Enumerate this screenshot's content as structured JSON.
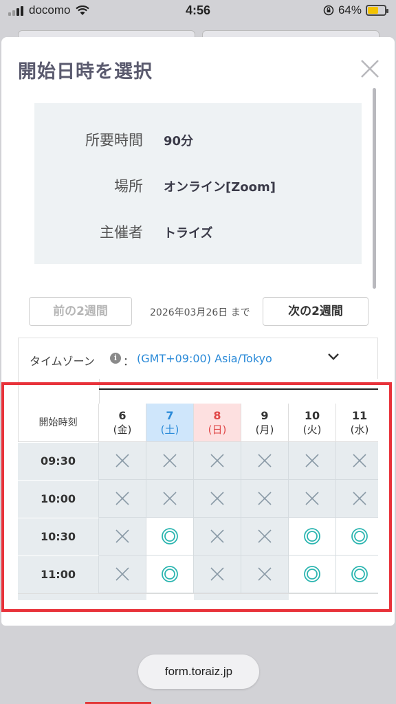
{
  "status_bar": {
    "carrier": "docomo",
    "time": "4:56",
    "battery": "64%",
    "battery_level": 0.64,
    "battery_color": "#f2c200"
  },
  "modal": {
    "title": "開始日時を選択",
    "close_icon": "close-icon",
    "info": [
      {
        "label": "所要時間",
        "value": "90分"
      },
      {
        "label": "場所",
        "value": "オンライン[Zoom]"
      },
      {
        "label": "主催者",
        "value": "トライズ"
      }
    ],
    "nav": {
      "prev_label": "前の2週間",
      "until_text": "2026年03月26日 まで",
      "next_label": "次の2週間"
    },
    "timezone": {
      "label": "タイムゾーン",
      "info_icon": "i",
      "colon": "：",
      "value": "(GMT+09:00) Asia/Tokyo"
    },
    "calendar": {
      "header_label": "開始時刻",
      "days": [
        {
          "num": "6",
          "weekday": "(金)",
          "kind": "weekday"
        },
        {
          "num": "7",
          "weekday": "(土)",
          "kind": "sat"
        },
        {
          "num": "8",
          "weekday": "(日)",
          "kind": "sun"
        },
        {
          "num": "9",
          "weekday": "(月)",
          "kind": "weekday"
        },
        {
          "num": "10",
          "weekday": "(火)",
          "kind": "weekday"
        },
        {
          "num": "11",
          "weekday": "(水)",
          "kind": "weekday"
        }
      ],
      "rows": [
        {
          "time": "09:30",
          "slots": [
            "x",
            "x",
            "x",
            "x",
            "x",
            "x"
          ]
        },
        {
          "time": "10:00",
          "slots": [
            "x",
            "x",
            "x",
            "x",
            "x",
            "x"
          ]
        },
        {
          "time": "10:30",
          "slots": [
            "x",
            "o",
            "x",
            "x",
            "o",
            "o"
          ]
        },
        {
          "time": "11:00",
          "slots": [
            "x",
            "o",
            "x",
            "x",
            "o",
            "o"
          ]
        }
      ],
      "colors": {
        "available": "#2bb5b0",
        "unavailable": "#8a9aa6",
        "saturday": "#2a8ad8",
        "sunday": "#e04848"
      }
    }
  },
  "browser": {
    "url": "form.toraiz.jp"
  },
  "highlight_color": "#e8323a"
}
